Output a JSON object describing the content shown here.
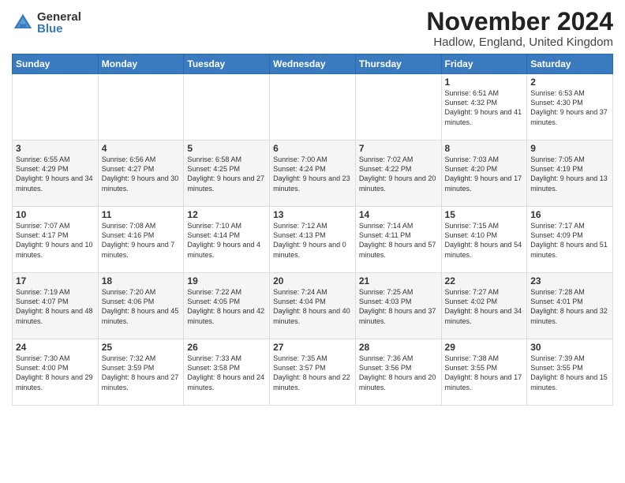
{
  "logo": {
    "general": "General",
    "blue": "Blue"
  },
  "title": "November 2024",
  "subtitle": "Hadlow, England, United Kingdom",
  "weekdays": [
    "Sunday",
    "Monday",
    "Tuesday",
    "Wednesday",
    "Thursday",
    "Friday",
    "Saturday"
  ],
  "weeks": [
    [
      {
        "day": "",
        "info": ""
      },
      {
        "day": "",
        "info": ""
      },
      {
        "day": "",
        "info": ""
      },
      {
        "day": "",
        "info": ""
      },
      {
        "day": "",
        "info": ""
      },
      {
        "day": "1",
        "info": "Sunrise: 6:51 AM\nSunset: 4:32 PM\nDaylight: 9 hours\nand 41 minutes."
      },
      {
        "day": "2",
        "info": "Sunrise: 6:53 AM\nSunset: 4:30 PM\nDaylight: 9 hours\nand 37 minutes."
      }
    ],
    [
      {
        "day": "3",
        "info": "Sunrise: 6:55 AM\nSunset: 4:29 PM\nDaylight: 9 hours\nand 34 minutes."
      },
      {
        "day": "4",
        "info": "Sunrise: 6:56 AM\nSunset: 4:27 PM\nDaylight: 9 hours\nand 30 minutes."
      },
      {
        "day": "5",
        "info": "Sunrise: 6:58 AM\nSunset: 4:25 PM\nDaylight: 9 hours\nand 27 minutes."
      },
      {
        "day": "6",
        "info": "Sunrise: 7:00 AM\nSunset: 4:24 PM\nDaylight: 9 hours\nand 23 minutes."
      },
      {
        "day": "7",
        "info": "Sunrise: 7:02 AM\nSunset: 4:22 PM\nDaylight: 9 hours\nand 20 minutes."
      },
      {
        "day": "8",
        "info": "Sunrise: 7:03 AM\nSunset: 4:20 PM\nDaylight: 9 hours\nand 17 minutes."
      },
      {
        "day": "9",
        "info": "Sunrise: 7:05 AM\nSunset: 4:19 PM\nDaylight: 9 hours\nand 13 minutes."
      }
    ],
    [
      {
        "day": "10",
        "info": "Sunrise: 7:07 AM\nSunset: 4:17 PM\nDaylight: 9 hours\nand 10 minutes."
      },
      {
        "day": "11",
        "info": "Sunrise: 7:08 AM\nSunset: 4:16 PM\nDaylight: 9 hours\nand 7 minutes."
      },
      {
        "day": "12",
        "info": "Sunrise: 7:10 AM\nSunset: 4:14 PM\nDaylight: 9 hours\nand 4 minutes."
      },
      {
        "day": "13",
        "info": "Sunrise: 7:12 AM\nSunset: 4:13 PM\nDaylight: 9 hours\nand 0 minutes."
      },
      {
        "day": "14",
        "info": "Sunrise: 7:14 AM\nSunset: 4:11 PM\nDaylight: 8 hours\nand 57 minutes."
      },
      {
        "day": "15",
        "info": "Sunrise: 7:15 AM\nSunset: 4:10 PM\nDaylight: 8 hours\nand 54 minutes."
      },
      {
        "day": "16",
        "info": "Sunrise: 7:17 AM\nSunset: 4:09 PM\nDaylight: 8 hours\nand 51 minutes."
      }
    ],
    [
      {
        "day": "17",
        "info": "Sunrise: 7:19 AM\nSunset: 4:07 PM\nDaylight: 8 hours\nand 48 minutes."
      },
      {
        "day": "18",
        "info": "Sunrise: 7:20 AM\nSunset: 4:06 PM\nDaylight: 8 hours\nand 45 minutes."
      },
      {
        "day": "19",
        "info": "Sunrise: 7:22 AM\nSunset: 4:05 PM\nDaylight: 8 hours\nand 42 minutes."
      },
      {
        "day": "20",
        "info": "Sunrise: 7:24 AM\nSunset: 4:04 PM\nDaylight: 8 hours\nand 40 minutes."
      },
      {
        "day": "21",
        "info": "Sunrise: 7:25 AM\nSunset: 4:03 PM\nDaylight: 8 hours\nand 37 minutes."
      },
      {
        "day": "22",
        "info": "Sunrise: 7:27 AM\nSunset: 4:02 PM\nDaylight: 8 hours\nand 34 minutes."
      },
      {
        "day": "23",
        "info": "Sunrise: 7:28 AM\nSunset: 4:01 PM\nDaylight: 8 hours\nand 32 minutes."
      }
    ],
    [
      {
        "day": "24",
        "info": "Sunrise: 7:30 AM\nSunset: 4:00 PM\nDaylight: 8 hours\nand 29 minutes."
      },
      {
        "day": "25",
        "info": "Sunrise: 7:32 AM\nSunset: 3:59 PM\nDaylight: 8 hours\nand 27 minutes."
      },
      {
        "day": "26",
        "info": "Sunrise: 7:33 AM\nSunset: 3:58 PM\nDaylight: 8 hours\nand 24 minutes."
      },
      {
        "day": "27",
        "info": "Sunrise: 7:35 AM\nSunset: 3:57 PM\nDaylight: 8 hours\nand 22 minutes."
      },
      {
        "day": "28",
        "info": "Sunrise: 7:36 AM\nSunset: 3:56 PM\nDaylight: 8 hours\nand 20 minutes."
      },
      {
        "day": "29",
        "info": "Sunrise: 7:38 AM\nSunset: 3:55 PM\nDaylight: 8 hours\nand 17 minutes."
      },
      {
        "day": "30",
        "info": "Sunrise: 7:39 AM\nSunset: 3:55 PM\nDaylight: 8 hours\nand 15 minutes."
      }
    ]
  ]
}
